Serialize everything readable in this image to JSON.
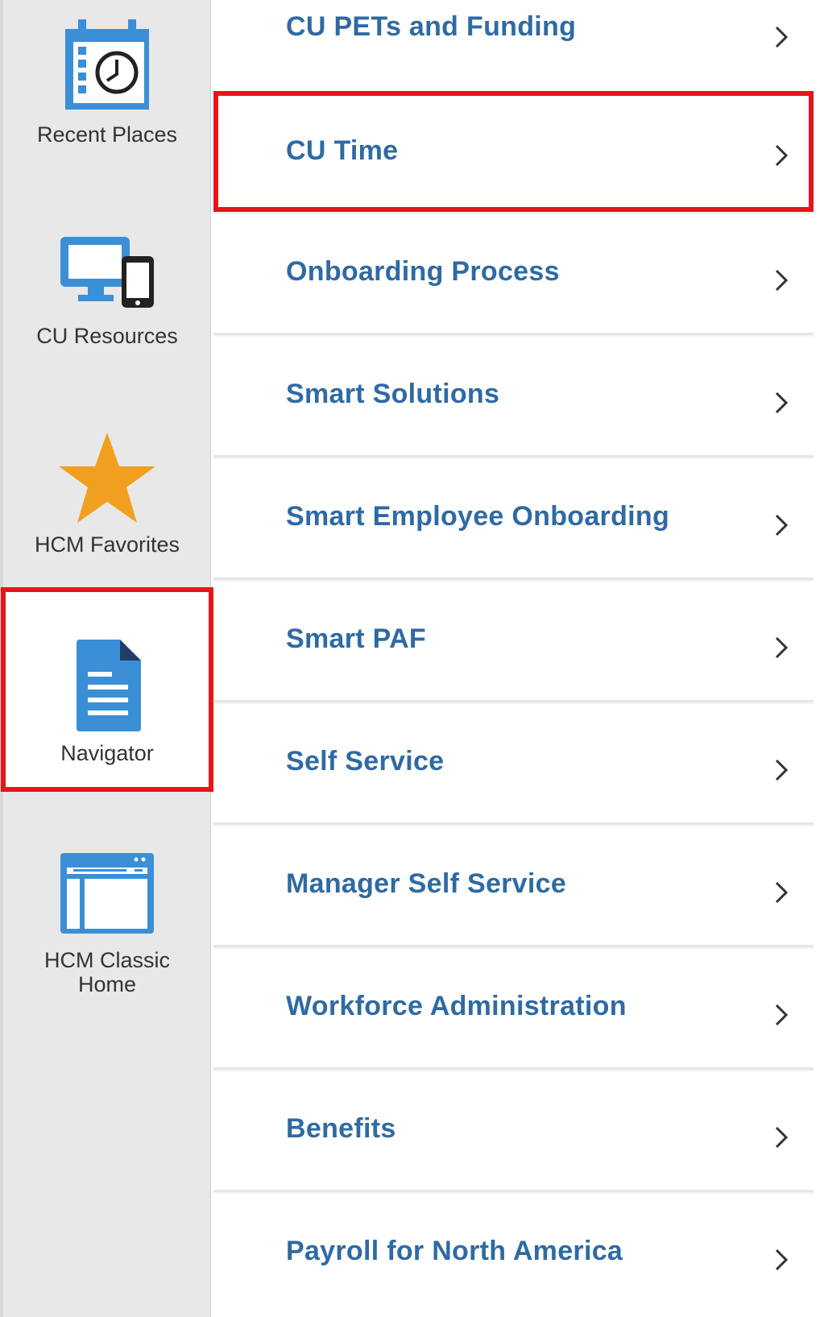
{
  "sidebar": {
    "items": [
      {
        "label": "Recent Places",
        "icon": "calendar-clock-icon"
      },
      {
        "label": "CU Resources",
        "icon": "devices-icon"
      },
      {
        "label": "HCM Favorites",
        "icon": "star-icon"
      },
      {
        "label": "Navigator",
        "icon": "document-icon",
        "selected": true
      },
      {
        "label": "HCM Classic Home",
        "label_lines": [
          "HCM Classic",
          "Home"
        ],
        "icon": "browser-window-icon"
      }
    ]
  },
  "main": {
    "rows": [
      {
        "label": "CU PETs and Funding",
        "icon": "chevron-right-icon"
      },
      {
        "label": "CU Time",
        "icon": "chevron-right-icon",
        "highlighted": true
      },
      {
        "label": "Onboarding Process",
        "icon": "chevron-right-icon"
      },
      {
        "label": "Smart Solutions",
        "icon": "chevron-right-icon"
      },
      {
        "label": "Smart Employee Onboarding",
        "icon": "chevron-right-icon"
      },
      {
        "label": "Smart PAF",
        "icon": "chevron-right-icon"
      },
      {
        "label": "Self Service",
        "icon": "chevron-right-icon"
      },
      {
        "label": "Manager Self Service",
        "icon": "chevron-right-icon"
      },
      {
        "label": "Workforce Administration",
        "icon": "chevron-right-icon"
      },
      {
        "label": "Benefits",
        "icon": "chevron-right-icon"
      },
      {
        "label": "Payroll for North America",
        "icon": "chevron-right-icon"
      }
    ]
  },
  "colors": {
    "link_blue": "#2f6aa3",
    "highlight_red": "#e8141a",
    "icon_blue": "#3a8fd6",
    "star_orange": "#f0a01e",
    "sidebar_bg": "#e8e8e8"
  }
}
